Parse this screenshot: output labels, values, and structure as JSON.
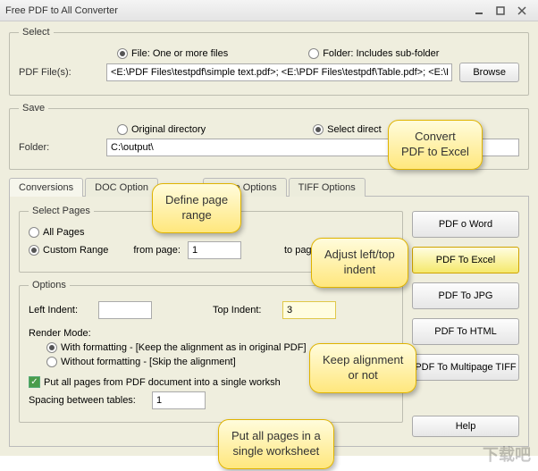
{
  "title": "Free PDF to All Converter",
  "select": {
    "legend": "Select",
    "fileRadio": "File:  One or more files",
    "folderRadio": "Folder: Includes sub-folder",
    "pdfFilesLabel": "PDF File(s):",
    "pdfFilesValue": "<E:\\PDF Files\\testpdf\\simple text.pdf>; <E:\\PDF Files\\testpdf\\Table.pdf>; <E:\\PDF",
    "browse": "Browse"
  },
  "save": {
    "legend": "Save",
    "origRadio": "Original directory",
    "selectRadio": "Select direct",
    "folderLabel": "Folder:",
    "folderValue": "C:\\output\\"
  },
  "tabs": [
    "Conversions",
    "DOC Option",
    "",
    "",
    "Image Options",
    "TIFF Options"
  ],
  "selectPages": {
    "legend": "Select Pages",
    "all": "All Pages",
    "custom": "Custom Range",
    "fromLbl": "from page:",
    "fromVal": "1",
    "toLbl": "to pag"
  },
  "options": {
    "legend": "Options",
    "leftIndentLbl": "Left Indent:",
    "leftIndentVal": "",
    "topIndentLbl": "Top Indent:",
    "topIndentVal": "3",
    "renderLbl": "Render Mode:",
    "withFmt": "With formatting - [Keep the alignment as in original PDF]",
    "noFmt": "Without formatting - [Skip the alignment]",
    "putAll": "Put all pages from PDF document into a single worksh",
    "spacingLbl": "Spacing between tables:",
    "spacingVal": "1"
  },
  "buttons": {
    "word": "PDF    o Word",
    "excel": "PDF To Excel",
    "jpg": "PDF To JPG",
    "html": "PDF To HTML",
    "tiff": "PDF To Multipage TIFF",
    "help": "Help"
  },
  "callouts": {
    "c1": "Convert\nPDF to Excel",
    "c2": "Define page\nrange",
    "c3": "Adjust left/top\nindent",
    "c4": "Keep alignment\nor not",
    "c5": "Put all pages in a\nsingle worksheet"
  },
  "watermark": "下载吧"
}
